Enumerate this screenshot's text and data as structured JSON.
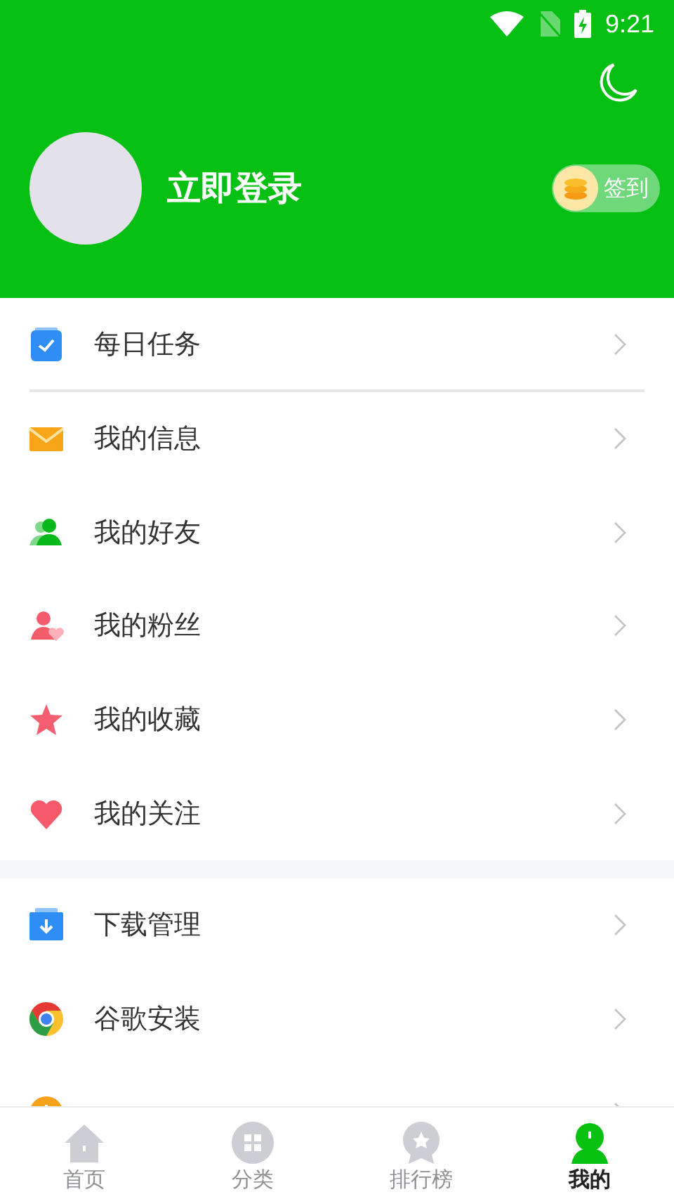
{
  "status_bar": {
    "time": "9:21"
  },
  "profile": {
    "login_label": "立即登录",
    "checkin_label": "签到"
  },
  "sections": [
    {
      "items": [
        {
          "label": "每日任务",
          "kind": "task",
          "divider": true
        },
        {
          "label": "我的信息",
          "kind": "mail",
          "divider": false
        },
        {
          "label": "我的好友",
          "kind": "friends",
          "divider": false
        },
        {
          "label": "我的粉丝",
          "kind": "fans",
          "divider": false
        },
        {
          "label": "我的收藏",
          "kind": "star",
          "divider": false
        },
        {
          "label": "我的关注",
          "kind": "heart",
          "divider": false
        }
      ]
    },
    {
      "items": [
        {
          "label": "下载管理",
          "kind": "download",
          "divider": false
        },
        {
          "label": "谷歌安装",
          "kind": "browser",
          "divider": false
        },
        {
          "kind": "history",
          "divider": false
        }
      ]
    }
  ],
  "tabs": [
    {
      "label": "首页",
      "kind": "home",
      "selected": false
    },
    {
      "label": "分类",
      "kind": "grid",
      "selected": false
    },
    {
      "label": "排行榜",
      "kind": "medal",
      "selected": false
    },
    {
      "label": "我的",
      "kind": "person",
      "selected": true
    }
  ]
}
